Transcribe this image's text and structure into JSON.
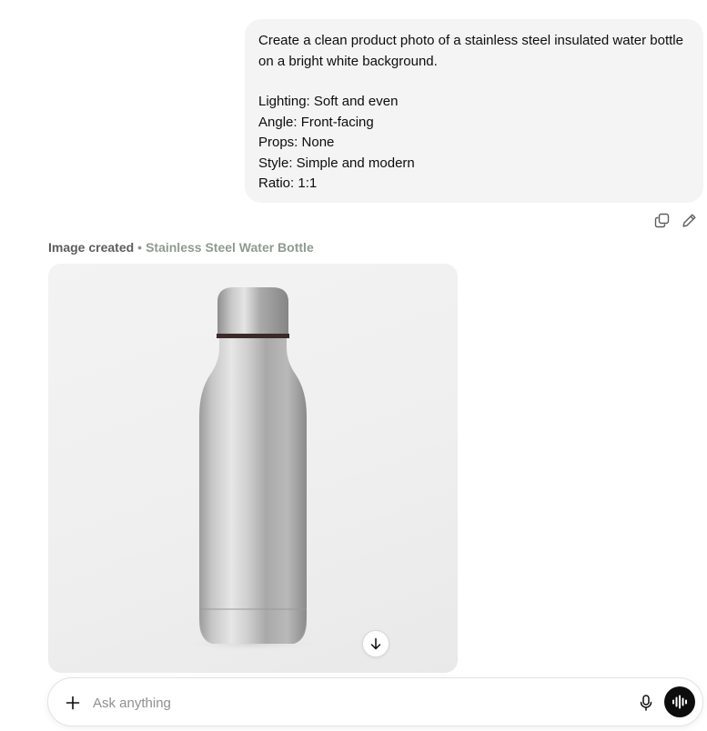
{
  "user_message": {
    "intro_line1": "Create a clean product photo of a stainless steel insulated water bottle",
    "intro_line2": "on a bright white background.",
    "lines": [
      "Lighting: Soft and even",
      "Angle: Front-facing",
      "Props: None",
      "Style: Simple and modern",
      "Ratio: 1:1"
    ]
  },
  "message_actions": {
    "copy_icon": "copy-icon",
    "edit_icon": "pencil-icon"
  },
  "image_result": {
    "label": "Image created",
    "separator": "•",
    "title": "Stainless Steel Water Bottle",
    "download_icon": "arrow-down-icon"
  },
  "composer": {
    "placeholder": "Ask anything",
    "plus_icon": "plus-icon",
    "mic_icon": "microphone-icon",
    "voice_icon": "voice-mode-icon"
  },
  "colors": {
    "bubble_bg": "#f4f4f4",
    "caption_title": "#8f9a91",
    "voice_button": "#0d0d0d"
  }
}
